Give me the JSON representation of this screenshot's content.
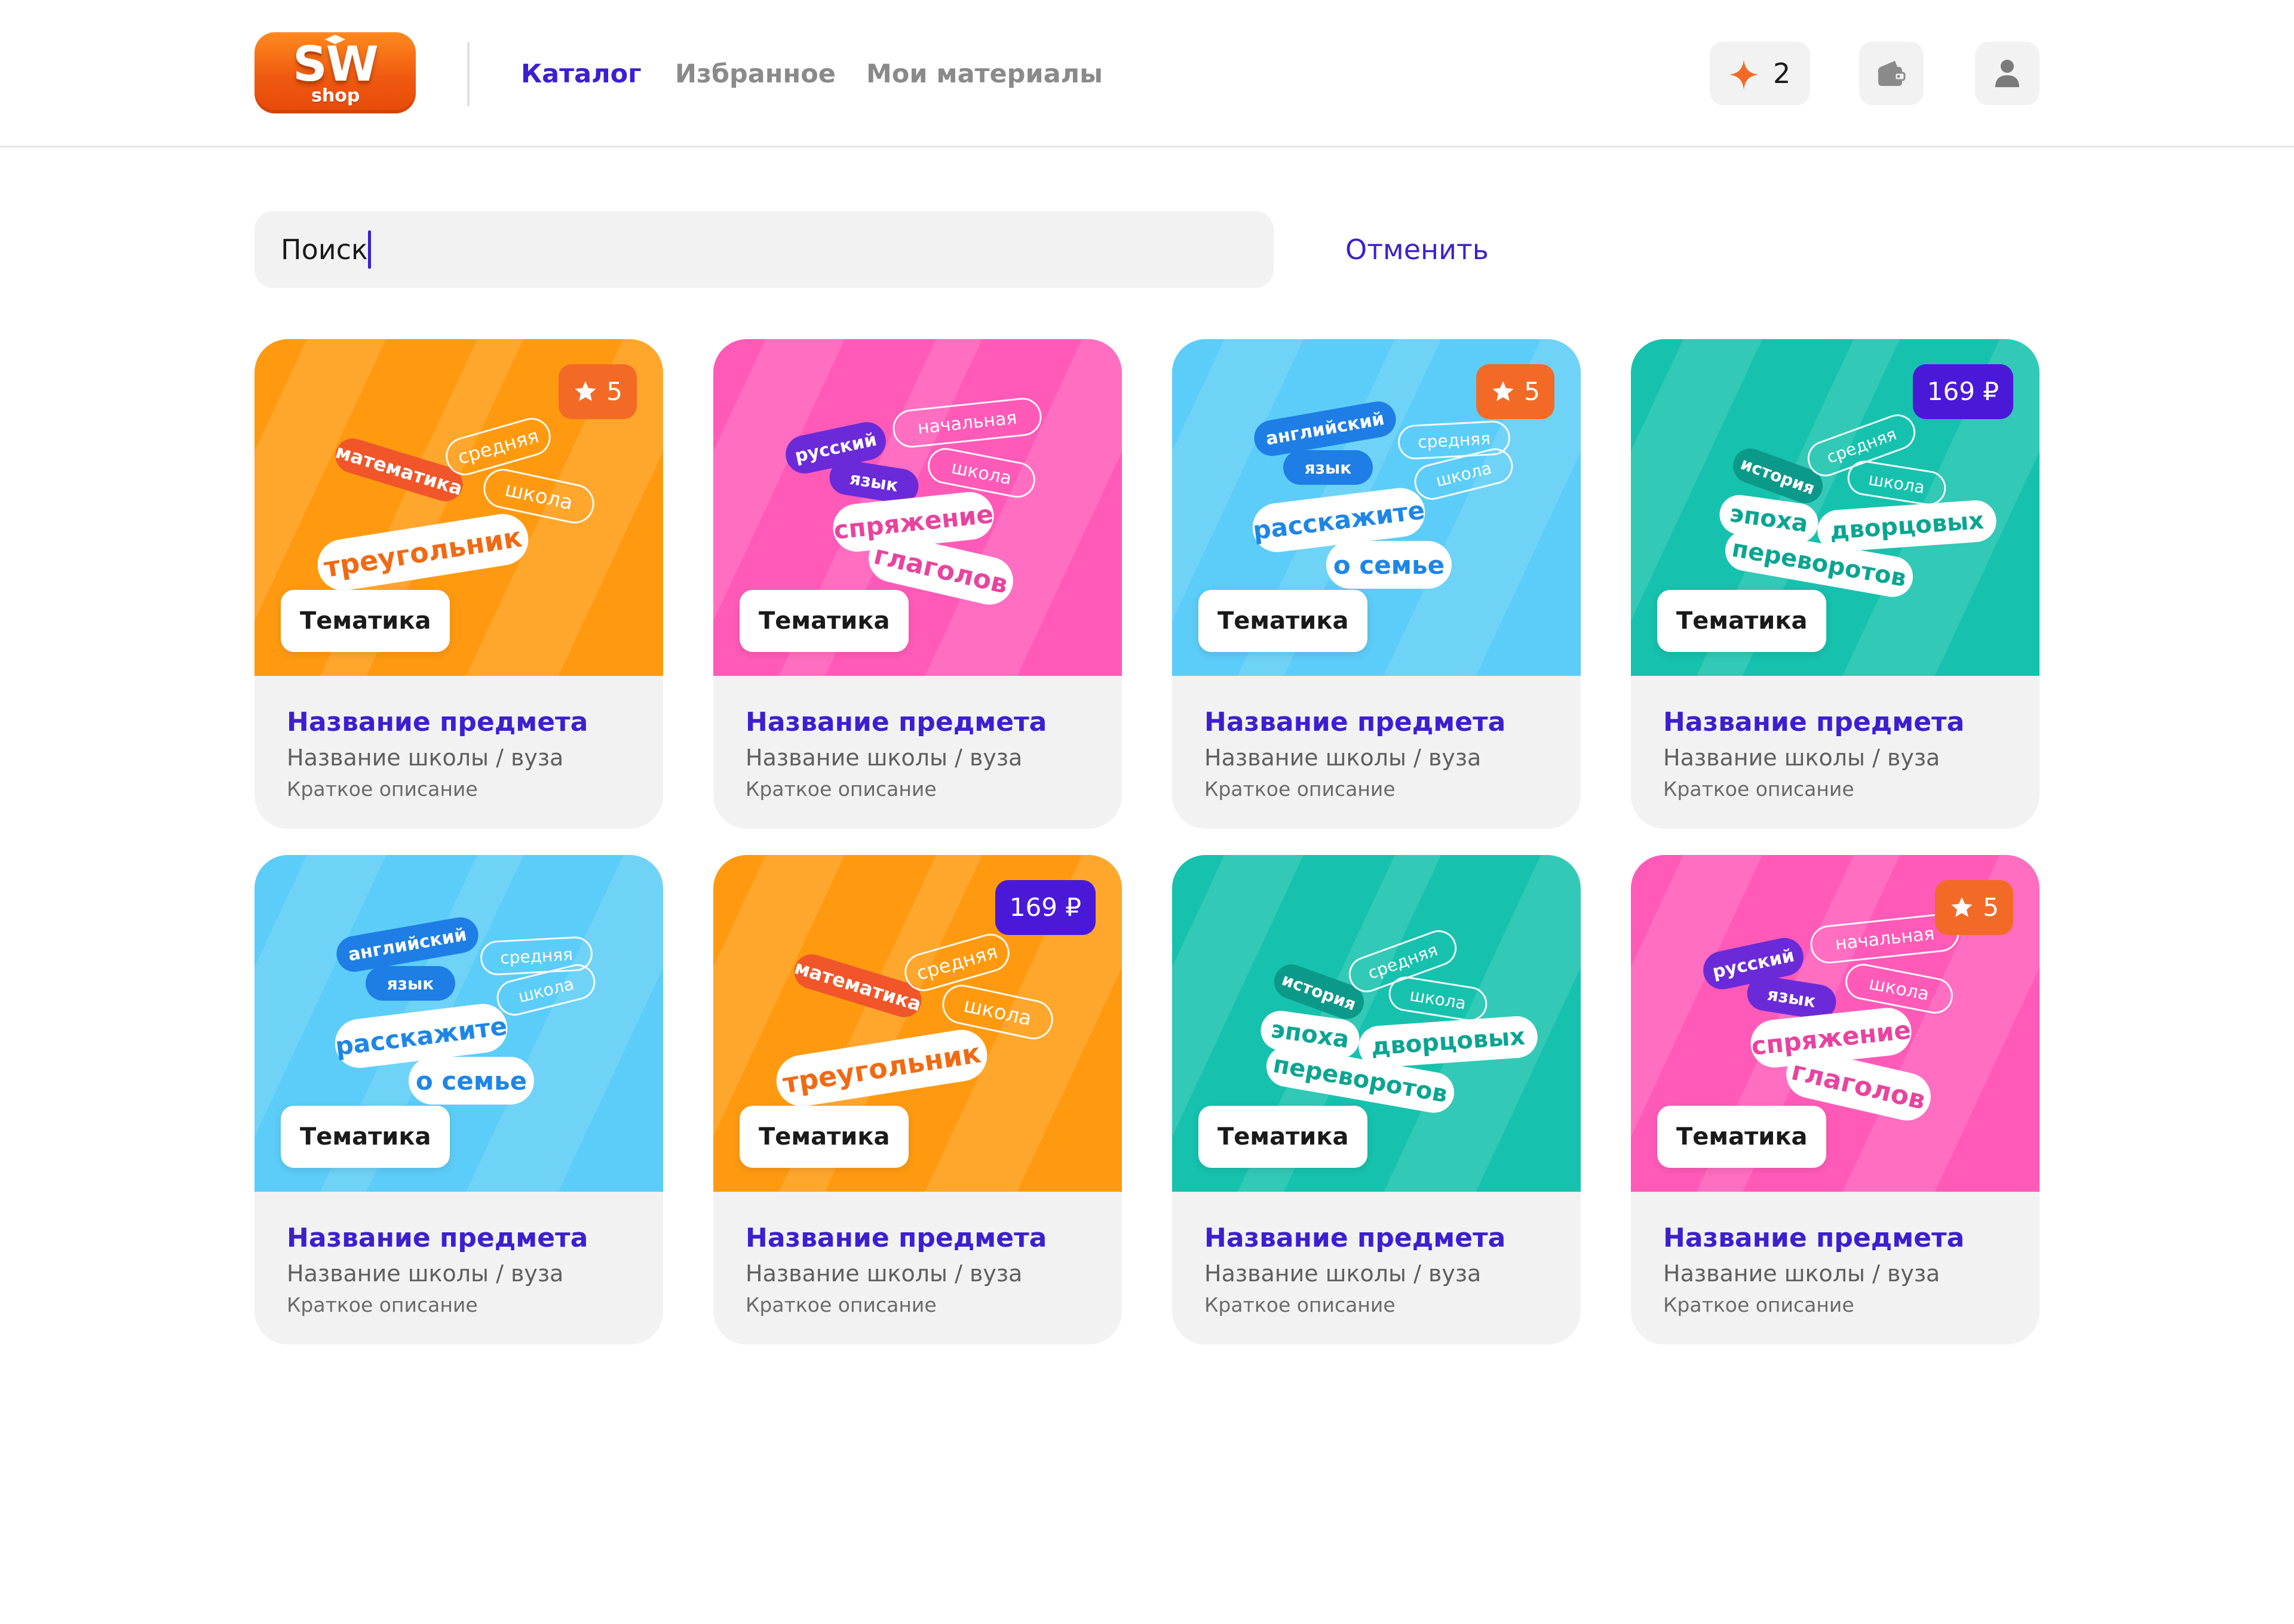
{
  "header": {
    "logo": {
      "main": "SW",
      "sub": "shop"
    },
    "nav": [
      {
        "label": "Каталог",
        "active": true
      },
      {
        "label": "Избранное",
        "active": false
      },
      {
        "label": "Мои материалы",
        "active": false
      }
    ],
    "bonus_count": "2",
    "icons": {
      "bonus": "sparkle-icon",
      "wallet": "wallet-icon",
      "profile": "user-icon"
    }
  },
  "search": {
    "value": "Поиск",
    "cancel_label": "Отменить"
  },
  "colors": {
    "accent": "#3d1fcf",
    "orange": "#ff9a10",
    "pink": "#ff5ab8",
    "blue": "#5ccdf8",
    "teal": "#16c2ad",
    "rating_badge": "#f36a26",
    "price_badge": "#4a19d8"
  },
  "themes": {
    "math": {
      "tags": [
        {
          "text": "математика",
          "style": "solid",
          "bg": "#f0562a",
          "fg": "#ffffff"
        },
        {
          "text": "средняя",
          "style": "outline"
        },
        {
          "text": "школа",
          "style": "outline"
        },
        {
          "text": "треугольник",
          "style": "white",
          "fg": "#f06a14"
        }
      ]
    },
    "russian": {
      "tags": [
        {
          "text": "русский",
          "style": "solid",
          "bg": "#6b2ad8",
          "fg": "#ffffff"
        },
        {
          "text": "начальная",
          "style": "outline"
        },
        {
          "text": "язык",
          "style": "solid",
          "bg": "#6b2ad8",
          "fg": "#ffffff"
        },
        {
          "text": "школа",
          "style": "outline"
        },
        {
          "text": "спряжение",
          "style": "white",
          "fg": "#e8439f"
        },
        {
          "text": "глаголов",
          "style": "white",
          "fg": "#e8439f"
        }
      ]
    },
    "english": {
      "tags": [
        {
          "text": "английский",
          "style": "solid",
          "bg": "#1e7ee6",
          "fg": "#ffffff"
        },
        {
          "text": "средняя",
          "style": "outline"
        },
        {
          "text": "язык",
          "style": "solid",
          "bg": "#1e7ee6",
          "fg": "#ffffff"
        },
        {
          "text": "школа",
          "style": "outline"
        },
        {
          "text": "расскажите",
          "style": "white",
          "fg": "#1e86e6"
        },
        {
          "text": "о семье",
          "style": "white",
          "fg": "#1e86e6"
        }
      ]
    },
    "history": {
      "tags": [
        {
          "text": "история",
          "style": "solid",
          "bg": "#0b9a8a",
          "fg": "#ffffff"
        },
        {
          "text": "средняя",
          "style": "outline"
        },
        {
          "text": "школа",
          "style": "outline"
        },
        {
          "text": "эпоха",
          "style": "white",
          "fg": "#0aa592"
        },
        {
          "text": "дворцовых",
          "style": "white",
          "fg": "#0aa592"
        },
        {
          "text": "переворотов",
          "style": "white",
          "fg": "#0aa592"
        }
      ]
    }
  },
  "cards": [
    {
      "theme": "math",
      "bg": "#ff9a10",
      "badge": {
        "type": "rating",
        "text": "5"
      },
      "theme_label": "Тематика",
      "title": "Название предмета",
      "school": "Название школы / вуза",
      "description": "Краткое описание"
    },
    {
      "theme": "russian",
      "bg": "#ff5ab8",
      "badge": null,
      "theme_label": "Тематика",
      "title": "Название предмета",
      "school": "Название школы / вуза",
      "description": "Краткое описание"
    },
    {
      "theme": "english",
      "bg": "#5ccdf8",
      "badge": {
        "type": "rating",
        "text": "5"
      },
      "theme_label": "Тематика",
      "title": "Название предмета",
      "school": "Название школы / вуза",
      "description": "Краткое описание"
    },
    {
      "theme": "history",
      "bg": "#16c2ad",
      "badge": {
        "type": "price",
        "text": "169 ₽"
      },
      "theme_label": "Тематика",
      "title": "Название предмета",
      "school": "Название школы / вуза",
      "description": "Краткое описание"
    },
    {
      "theme": "english",
      "bg": "#5ccdf8",
      "badge": null,
      "theme_label": "Тематика",
      "title": "Название предмета",
      "school": "Название школы / вуза",
      "description": "Краткое описание"
    },
    {
      "theme": "math",
      "bg": "#ff9a10",
      "badge": {
        "type": "price",
        "text": "169 ₽"
      },
      "theme_label": "Тематика",
      "title": "Название предмета",
      "school": "Название школы / вуза",
      "description": "Краткое описание"
    },
    {
      "theme": "history",
      "bg": "#16c2ad",
      "badge": null,
      "theme_label": "Тематика",
      "title": "Название предмета",
      "school": "Название школы / вуза",
      "description": "Краткое описание"
    },
    {
      "theme": "russian",
      "bg": "#ff5ab8",
      "badge": {
        "type": "rating",
        "text": "5"
      },
      "theme_label": "Тематика",
      "title": "Название предмета",
      "school": "Название школы / вуза",
      "description": "Краткое описание"
    }
  ]
}
